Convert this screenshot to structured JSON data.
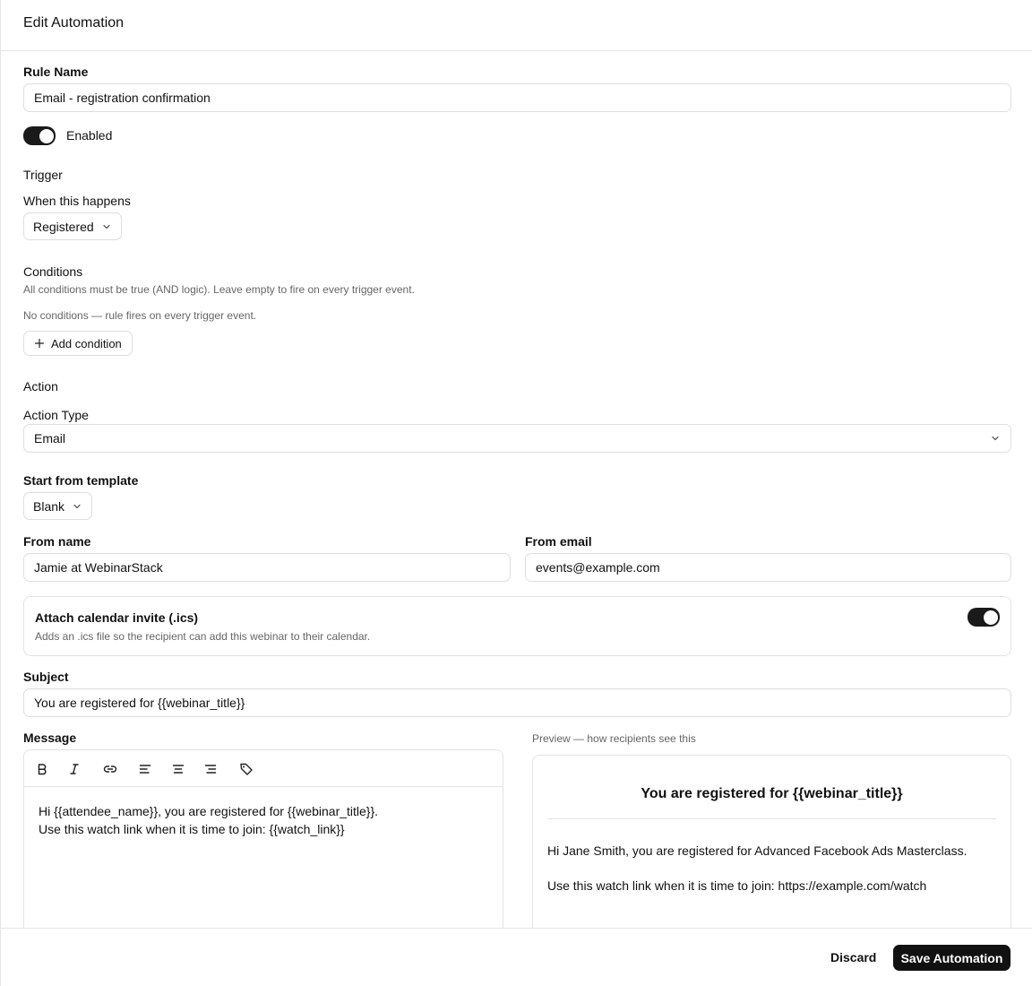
{
  "header": {
    "title": "Edit Automation"
  },
  "rule": {
    "label": "Rule Name",
    "value": "Email - registration confirmation"
  },
  "enabled": {
    "label": "Enabled",
    "on": true
  },
  "trigger": {
    "section_title": "Trigger",
    "label": "When this happens",
    "value": "Registered"
  },
  "conditions": {
    "section_title": "Conditions",
    "help": "All conditions must be true (AND logic). Leave empty to fire on every trigger event.",
    "empty": "No conditions — rule fires on every trigger event.",
    "add_label": "Add condition"
  },
  "action": {
    "section_title": "Action",
    "type_label": "Action Type",
    "type_value": "Email",
    "template_label": "Start from template",
    "template_value": "Blank",
    "from_name_label": "From name",
    "from_name_value": "Jamie at WebinarStack",
    "from_email_label": "From email",
    "from_email_value": "events@example.com",
    "calendar_title": "Attach calendar invite (.ics)",
    "calendar_desc": "Adds an .ics file so the recipient can add this webinar to their calendar.",
    "calendar_on": true,
    "subject_label": "Subject",
    "subject_value": "You are registered for {{webinar_title}}",
    "message_label": "Message",
    "message_lines": [
      "Hi {{attendee_name}}, you are registered for {{webinar_title}}.",
      "Use this watch link when it is time to join: {{watch_link}}"
    ],
    "toolbar_icons": [
      "bold-icon",
      "italic-icon",
      "link-icon",
      "align-left-icon",
      "align-center-icon",
      "align-right-icon",
      "tag-icon"
    ]
  },
  "preview": {
    "label": "Preview — how recipients see this",
    "title": "You are registered for {{webinar_title}}",
    "line1": "Hi Jane Smith, you are registered for Advanced Facebook Ads Masterclass.",
    "line2": "Use this watch link when it is time to join: https://example.com/watch"
  },
  "footer": {
    "discard": "Discard",
    "save": "Save Automation"
  }
}
